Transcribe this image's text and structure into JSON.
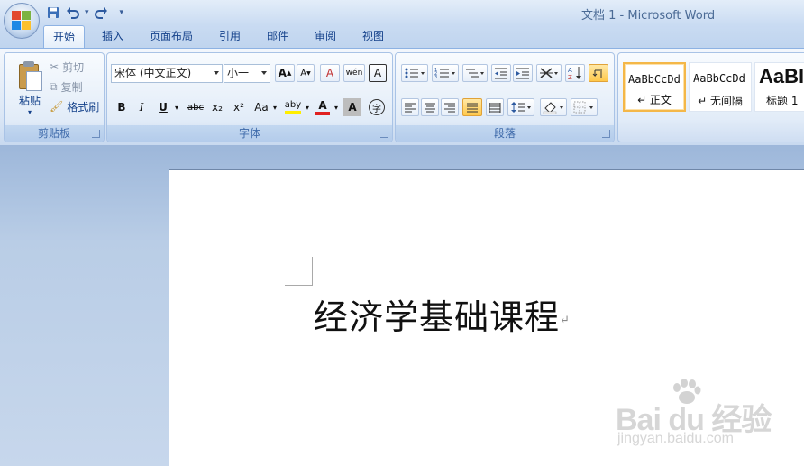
{
  "title_bar": {
    "title": "文档 1 - Microsoft Word",
    "qat": {
      "save_icon": "save-icon",
      "undo_icon": "undo-icon",
      "redo_icon": "redo-icon",
      "customize": "▾"
    }
  },
  "tabs": [
    {
      "label": "开始",
      "active": true
    },
    {
      "label": "插入"
    },
    {
      "label": "页面布局"
    },
    {
      "label": "引用"
    },
    {
      "label": "邮件"
    },
    {
      "label": "审阅"
    },
    {
      "label": "视图"
    }
  ],
  "ribbon": {
    "clipboard": {
      "label": "剪贴板",
      "paste": "粘贴",
      "cut": "剪切",
      "copy": "复制",
      "format_painter": "格式刷"
    },
    "font": {
      "label": "字体",
      "font_name": "宋体 (中文正文)",
      "font_size": "小一",
      "grow": "A",
      "shrink": "A",
      "clear": "A",
      "phonetic": "wén",
      "border": "A",
      "bold": "B",
      "italic": "I",
      "underline": "U",
      "strike": "abc",
      "subscript": "x₂",
      "superscript": "x²",
      "change_case": "Aa",
      "highlight": "aby",
      "font_color": "A",
      "shading": "A",
      "enclose": "字",
      "highlight_color": "#ffee00",
      "font_color_value": "#e02020"
    },
    "paragraph": {
      "label": "段落"
    },
    "styles": {
      "items": [
        {
          "sample": "AaBbCcDd",
          "name": "↵ 正文",
          "selected": true
        },
        {
          "sample": "AaBbCcDd",
          "name": "↵ 无间隔"
        },
        {
          "sample": "AaBl",
          "name": "标题 1"
        }
      ]
    }
  },
  "document": {
    "text": "经济学基础课程",
    "paragraph_mark": "↵"
  },
  "watermark": {
    "main": "Bai du 经验",
    "sub": "jingyan.baidu.com"
  }
}
